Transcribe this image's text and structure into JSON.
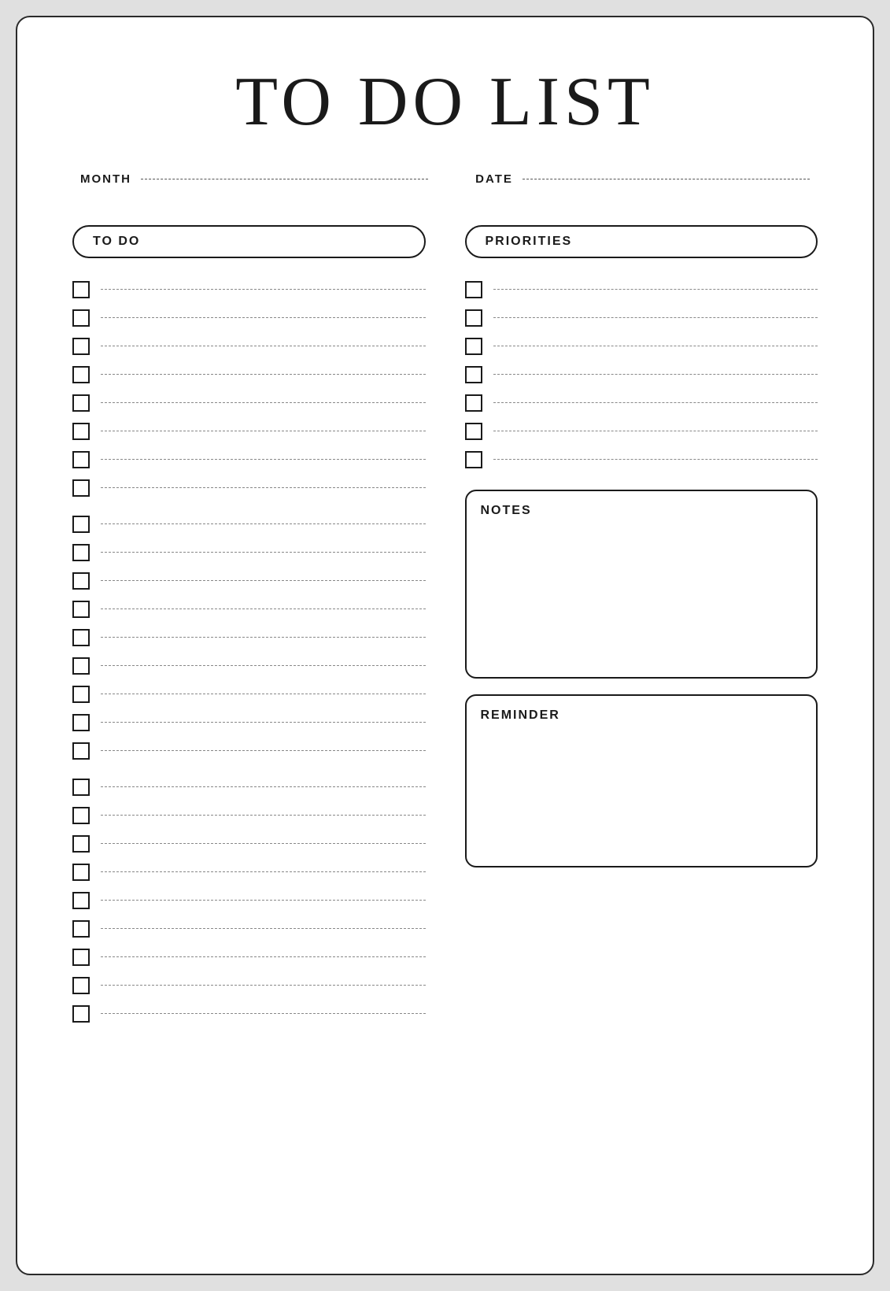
{
  "page": {
    "title": "TO DO LIST",
    "meta": {
      "month_label": "MONTH",
      "date_label": "DATE"
    },
    "todo_header": "TO DO",
    "priorities_header": "PRIORITIES",
    "notes_label": "NOTES",
    "reminder_label": "REMINDER",
    "todo_items_count": 26,
    "priorities_items_count": 7
  }
}
